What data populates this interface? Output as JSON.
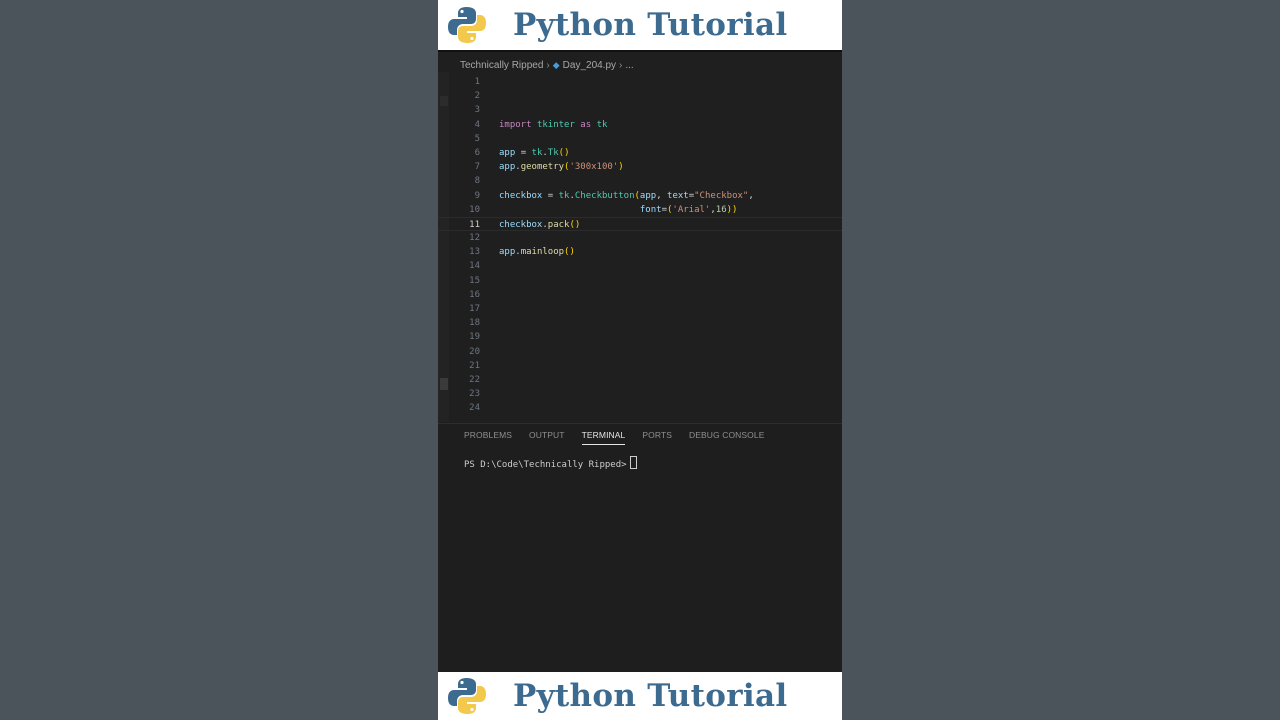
{
  "banner": {
    "title": "Python Tutorial"
  },
  "editor": {
    "breadcrumb": {
      "folder": "Technically Ripped",
      "file": "Day_204.py",
      "more": "..."
    },
    "current_line": 11,
    "lines": [
      {
        "n": "1",
        "code": ""
      },
      {
        "n": "2",
        "code": ""
      },
      {
        "n": "3",
        "code": ""
      },
      {
        "n": "4",
        "code": "import tkinter as tk"
      },
      {
        "n": "5",
        "code": ""
      },
      {
        "n": "6",
        "code": "app = tk.Tk()"
      },
      {
        "n": "7",
        "code": "app.geometry('300x100')"
      },
      {
        "n": "8",
        "code": ""
      },
      {
        "n": "9",
        "code": "checkbox = tk.Checkbutton(app, text=\"Checkbox\","
      },
      {
        "n": "10",
        "code": "                          font=('Arial',16))"
      },
      {
        "n": "11",
        "code": "checkbox.pack()"
      },
      {
        "n": "12",
        "code": ""
      },
      {
        "n": "13",
        "code": "app.mainloop()"
      },
      {
        "n": "14",
        "code": ""
      },
      {
        "n": "15",
        "code": ""
      },
      {
        "n": "16",
        "code": ""
      },
      {
        "n": "17",
        "code": ""
      },
      {
        "n": "18",
        "code": ""
      },
      {
        "n": "19",
        "code": ""
      },
      {
        "n": "20",
        "code": ""
      },
      {
        "n": "21",
        "code": ""
      },
      {
        "n": "22",
        "code": ""
      },
      {
        "n": "23",
        "code": ""
      },
      {
        "n": "24",
        "code": ""
      }
    ]
  },
  "panel": {
    "tabs": [
      "PROBLEMS",
      "OUTPUT",
      "TERMINAL",
      "PORTS",
      "DEBUG CONSOLE"
    ],
    "active_tab": "TERMINAL",
    "prompt": "PS D:\\Code\\Technically Ripped>"
  },
  "colors": {
    "banner_title": "#3d6a8f",
    "editor_bg": "#1f1f1f",
    "keyword": "#c586c0",
    "string": "#ce9178"
  }
}
